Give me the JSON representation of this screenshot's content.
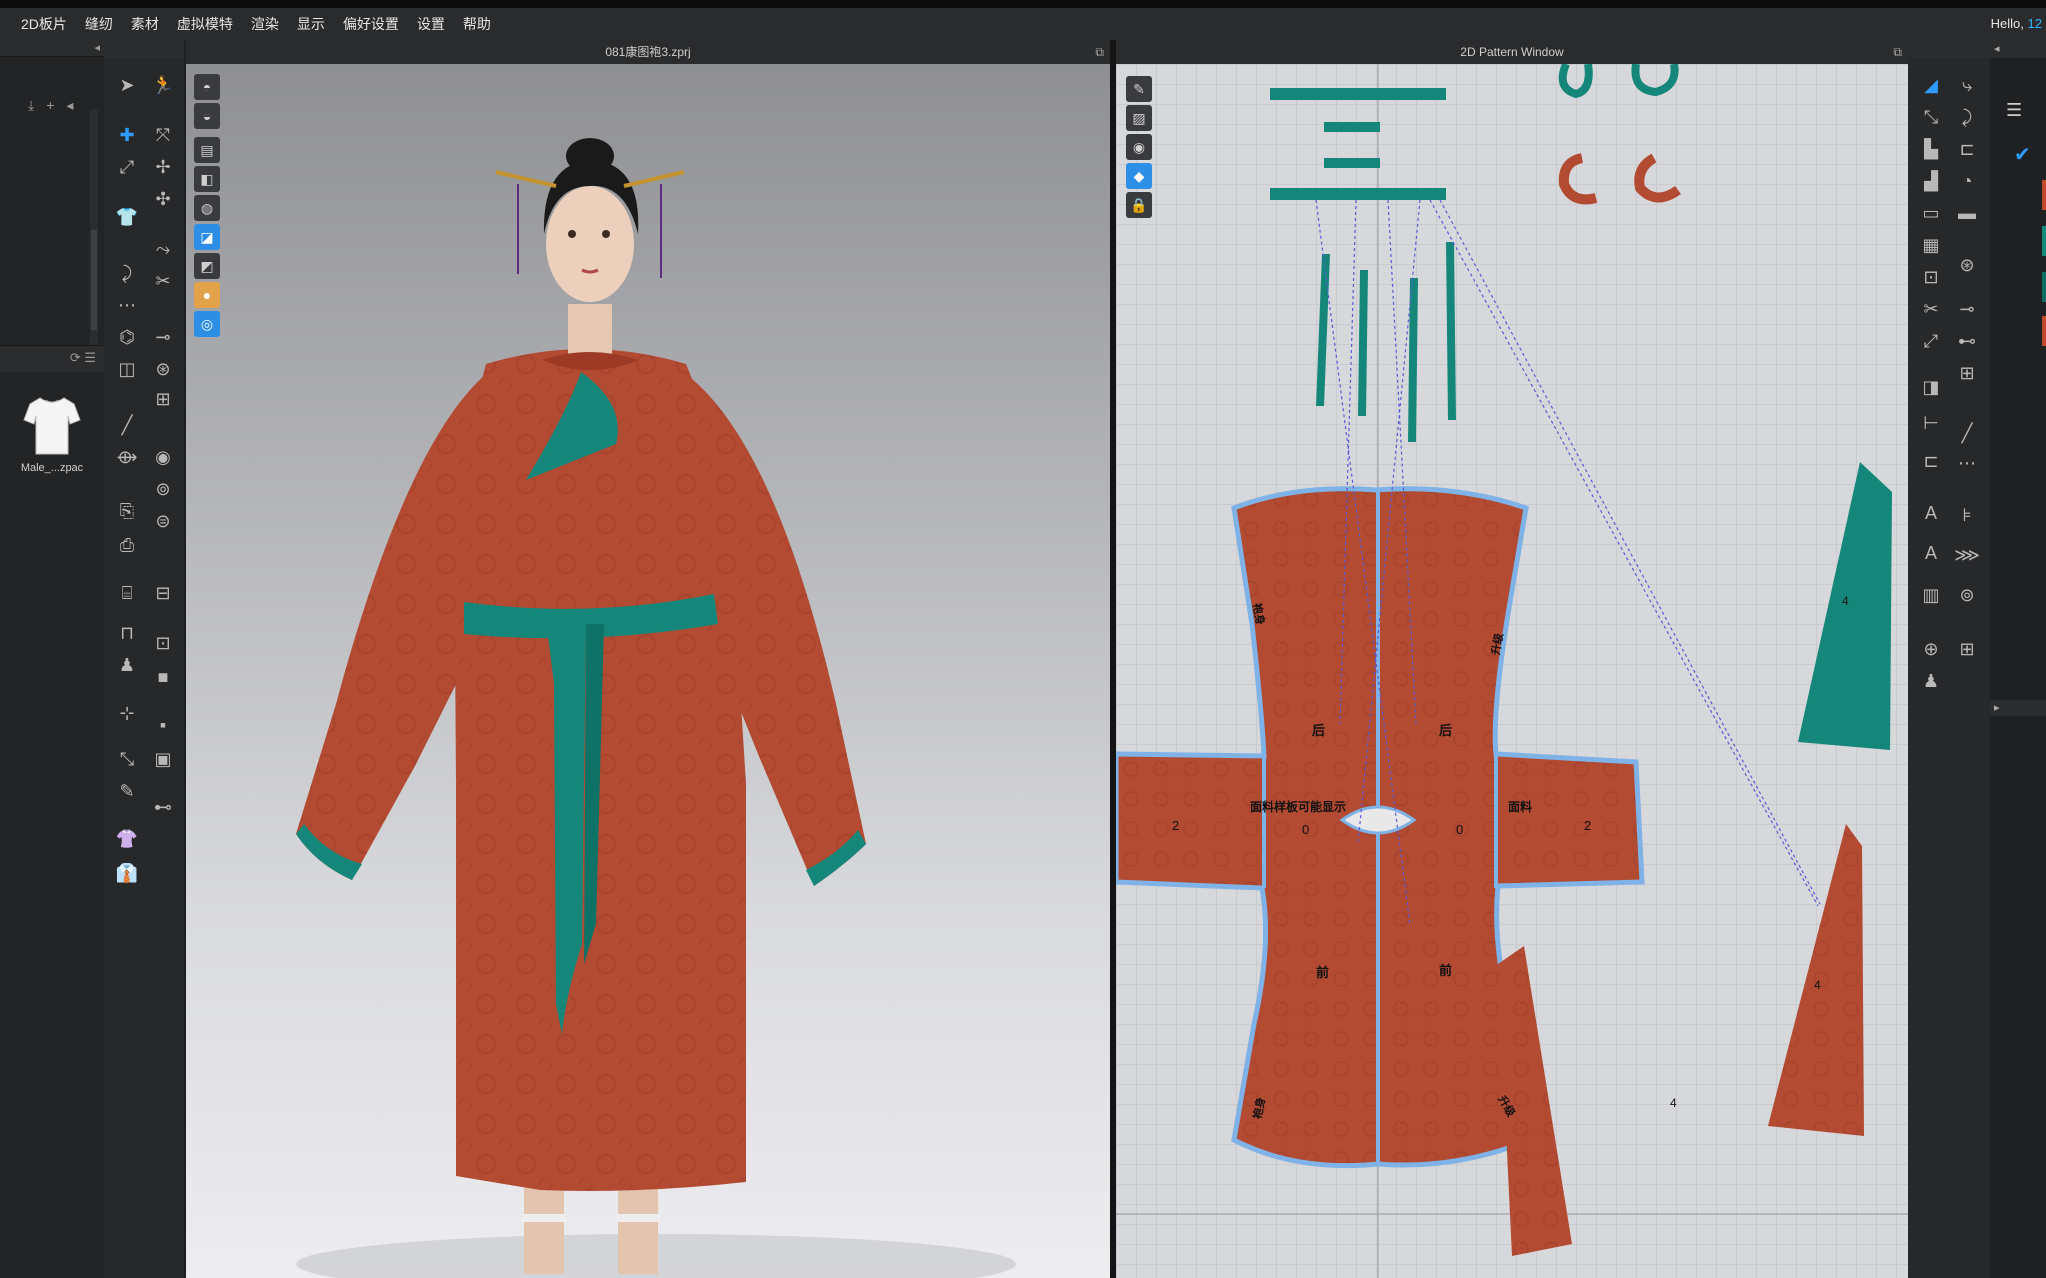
{
  "menu": {
    "items": [
      "2D板片",
      "缝纫",
      "素材",
      "虚拟模特",
      "渲染",
      "显示",
      "偏好设置",
      "设置",
      "帮助"
    ],
    "greeting": "Hello,",
    "user_fragment": "12"
  },
  "library": {
    "item_label": "Male_...zpac"
  },
  "view3d": {
    "title": "081康图袍3.zprj"
  },
  "view2d": {
    "title": "2D Pattern Window",
    "labels": {
      "back_left": "后",
      "back_right": "后",
      "front_left": "前",
      "front_right": "前",
      "note": "面料样板可能显示",
      "note_short": "面料",
      "zero_left": "0",
      "zero_right": "0",
      "sleeve_left": "2",
      "sleeve_right": "2",
      "piece_4a": "4",
      "piece_4b": "4",
      "piece_4c": "4",
      "tag_a": "袍身",
      "tag_b": "升级",
      "tag_c": "袍身",
      "tag_d": "升级"
    }
  },
  "colors": {
    "garment_red": "#b34a32",
    "garment_teal": "#14877a",
    "outline_blue": "#7fb2e6",
    "accent_blue": "#2d9bff"
  }
}
